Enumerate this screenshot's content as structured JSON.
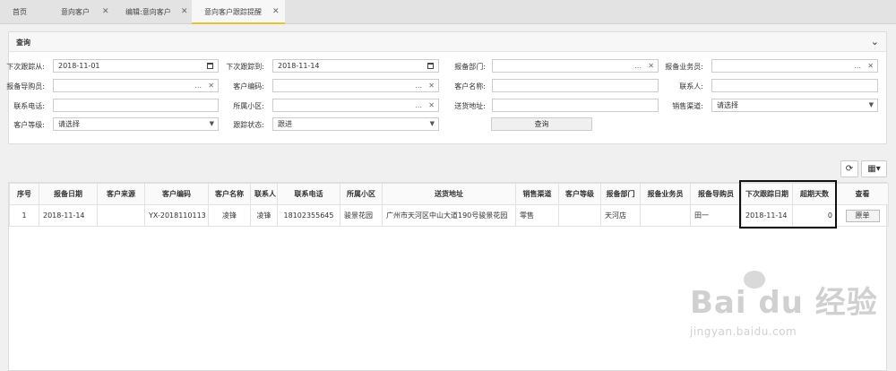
{
  "tabs": [
    {
      "label": "首页",
      "closable": false
    },
    {
      "label": "意向客户",
      "closable": true
    },
    {
      "label": "编辑:意向客户",
      "closable": true
    },
    {
      "label": "意向客户跟踪提醒",
      "closable": true,
      "active": true
    }
  ],
  "query": {
    "title": "查询",
    "next_follow_from_label": "下次跟踪从:",
    "next_follow_from_value": "2018-11-01",
    "next_follow_to_label": "下次跟踪到:",
    "next_follow_to_value": "2018-11-14",
    "report_dept_label": "报备部门:",
    "report_salesman_label": "报备业务员:",
    "report_guide_label": "报备导购员:",
    "customer_code_label": "客户编码:",
    "customer_name_label": "客户名称:",
    "contact_label": "联系人:",
    "phone_label": "联系电话:",
    "community_label": "所属小区:",
    "address_label": "送货地址:",
    "sales_channel_label": "销售渠道:",
    "sales_channel_value": "请选择",
    "customer_level_label": "客户等级:",
    "customer_level_value": "请选择",
    "follow_status_label": "跟踪状态:",
    "follow_status_value": "跟进",
    "dots": "...",
    "clear": "✕",
    "query_button": "查询"
  },
  "toolbar": {
    "refresh_icon": "refresh-icon",
    "columns_icon": "grid-icon"
  },
  "table": {
    "headers": [
      "序号",
      "报备日期",
      "客户来源",
      "客户编码",
      "客户名称",
      "联系人",
      "联系电话",
      "所属小区",
      "送货地址",
      "销售渠道",
      "客户等级",
      "报备部门",
      "报备业务员",
      "报备导购员",
      "下次跟踪日期",
      "超期天数",
      "查看"
    ],
    "rows": [
      {
        "index": "1",
        "report_date": "2018-11-14",
        "source": "",
        "code": "YX-2018110113",
        "name": "凌锋",
        "contact": "凌锋",
        "phone": "18102355645",
        "community": "骏景花园",
        "address": "广州市天河区中山大道190号骏景花园",
        "channel": "零售",
        "level": "",
        "dept": "天河店",
        "salesman": "",
        "guide": "田一",
        "next_date": "2018-11-14",
        "overdue_days": "0",
        "view_label": "原单"
      }
    ]
  },
  "watermark": {
    "logo": "Bai du 经验",
    "url": "jingyan.baidu.com"
  }
}
